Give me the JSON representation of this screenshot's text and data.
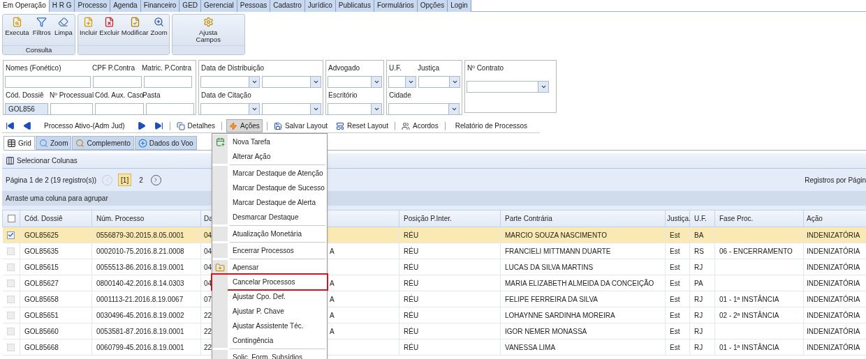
{
  "main_tabs": [
    {
      "label": "Em Operação",
      "selected": true
    },
    {
      "label": "H R G",
      "selected": false
    },
    {
      "label": "Processo",
      "selected": false
    },
    {
      "label": "Agenda",
      "selected": false
    },
    {
      "label": "Financeiro",
      "selected": false
    },
    {
      "label": "GED",
      "selected": false
    },
    {
      "label": "Gerencial",
      "selected": false
    },
    {
      "label": "Pessoas",
      "selected": false
    },
    {
      "label": "Cadastro",
      "selected": false
    },
    {
      "label": "Jurídico",
      "selected": false
    },
    {
      "label": "Publicatus",
      "selected": false
    },
    {
      "label": "Formulários",
      "selected": false
    },
    {
      "label": "Opções",
      "selected": false
    },
    {
      "label": "Login",
      "selected": false
    }
  ],
  "ribbon_groups": [
    {
      "label": "Consulta",
      "buttons": [
        "Executa",
        "Filtros",
        "Limpa"
      ]
    },
    {
      "buttons": [
        "Incluir",
        "Excluir",
        "Modificar",
        "Zoom"
      ]
    },
    {
      "buttons": [
        "Ajusta Campos"
      ]
    }
  ],
  "filter_boxes": [
    {
      "rows": [
        {
          "labels": [
            "Nomes (Fonético)",
            "CPF P.Contra",
            "Matric. P.Contra"
          ],
          "fields": [
            {
              "kind": "text"
            },
            {
              "kind": "text"
            },
            {
              "kind": "text"
            }
          ]
        },
        {
          "labels": [
            "Cód. Dossiê",
            "Nº Processual",
            "Cód. Aux. Caso",
            "Pasta"
          ],
          "fields": [
            {
              "kind": "text",
              "value": "GOL856",
              "focused": true
            },
            {
              "kind": "text"
            },
            {
              "kind": "text"
            },
            {
              "kind": "text"
            }
          ]
        }
      ]
    },
    {
      "rows": [
        {
          "labels": [
            "Data de Distribuição"
          ],
          "fields": [
            {
              "kind": "select"
            },
            {
              "kind": "select"
            }
          ]
        },
        {
          "labels": [
            "Data de Citação"
          ],
          "fields": [
            {
              "kind": "select"
            },
            {
              "kind": "select"
            }
          ]
        }
      ]
    },
    {
      "rows": [
        {
          "labels": [
            "Advogado"
          ],
          "fields": [
            {
              "kind": "select"
            }
          ]
        },
        {
          "labels": [
            "Escritório"
          ],
          "fields": [
            {
              "kind": "select"
            }
          ]
        }
      ]
    },
    {
      "rows": [
        {
          "labels": [
            "U.F.",
            "Justiça"
          ],
          "fields": [
            {
              "kind": "select"
            },
            {
              "kind": "select"
            }
          ]
        },
        {
          "labels": [
            "Cidade"
          ],
          "fields": [
            {
              "kind": "select"
            }
          ]
        }
      ]
    },
    {
      "rows": [
        {
          "labels": [
            "Nº Contrato"
          ],
          "fields": [
            {
              "kind": "select"
            }
          ]
        }
      ]
    }
  ],
  "toolbar": [
    {
      "kind": "first"
    },
    {
      "kind": "prev"
    },
    {
      "kind": "text",
      "label": "Processo Ativo-(Adm Jud)"
    },
    {
      "kind": "next"
    },
    {
      "kind": "last"
    },
    {
      "kind": "separator"
    },
    {
      "kind": "details",
      "label": "Detalhes"
    },
    {
      "kind": "separator"
    },
    {
      "kind": "actions",
      "label": "Ações",
      "pressed": true
    },
    {
      "kind": "separator"
    },
    {
      "kind": "save",
      "label": "Salvar Layout"
    },
    {
      "kind": "reset",
      "label": "Reset Layout"
    },
    {
      "kind": "separator"
    },
    {
      "kind": "deals",
      "label": "Acordos"
    },
    {
      "kind": "separator"
    },
    {
      "kind": "text",
      "label": "Relatório de Processos"
    }
  ],
  "view_tabs": [
    {
      "label": "Grid",
      "selected": true
    },
    {
      "label": "Zoom",
      "selected": false
    },
    {
      "label": "Complemento",
      "selected": false
    },
    {
      "label": "Dados do Voo",
      "selected": false
    }
  ],
  "select_columns_button": "Selecionar Colunas",
  "pagination": {
    "summary": "Página 1 de 2 (19 registro(s))",
    "pages": [
      {
        "label": "[1]",
        "selected": true
      },
      {
        "label": "2",
        "selected": false
      }
    ],
    "prev_disabled": true,
    "per_page_label": "Registros por Págin"
  },
  "group_hint": "Arraste uma coluna para agrupar",
  "table": {
    "select_all_checked": false,
    "columns": [
      "Cód. Dossiê",
      "Núm. Processo",
      "Da",
      "",
      "Posição P.Inter.",
      "Parte Contrária",
      "Justiça.",
      "U.F.",
      "Fase Proc.",
      "Ação"
    ],
    "rows": [
      {
        "checked": true,
        "selected": true,
        "cells": [
          "GOL85625",
          "0556879-30.2015.8.05.0001",
          "04",
          "",
          "RÉU",
          "MARCIO SOUZA NASCIMENTO",
          "Est",
          "BA",
          "",
          "INDENIZATÓRIA"
        ]
      },
      {
        "checked": false,
        "selected": false,
        "cells": [
          "GOL85635",
          "0002010-75.2016.8.21.0008",
          "04",
          "A",
          "RÉU",
          "FRANCIELI MITTMANN DUARTE",
          "Est",
          "RS",
          "06 - ENCERRAMENTO",
          "INDENIZATÓRIA"
        ]
      },
      {
        "checked": false,
        "selected": false,
        "cells": [
          "GOL85615",
          "0055513-86.2016.8.19.0001",
          "04",
          "",
          "RÉU",
          "LUCAS DA SILVA MARTINS",
          "Est",
          "RJ",
          "",
          "INDENIZATÓRIA"
        ]
      },
      {
        "checked": false,
        "selected": false,
        "cells": [
          "GOL85627",
          "0800140-42.2016.8.14.0303",
          "04",
          "A",
          "RÉU",
          "MARIA ELIZABETH ALMEIDA DA CONCEIÇÃO",
          "Est",
          "PA",
          "",
          "INDENIZATÓRIA"
        ]
      },
      {
        "checked": false,
        "selected": false,
        "cells": [
          "GOL85658",
          "0001113-21.2016.8.19.0067",
          "07",
          "A",
          "RÉU",
          "FELIPE FERREIRA DA SILVA",
          "Est",
          "RJ",
          "01 - 1ª INSTÂNCIA",
          "INDENIZATÓRIA"
        ]
      },
      {
        "checked": false,
        "selected": false,
        "cells": [
          "GOL85651",
          "0030496-45.2016.8.19.0002",
          "22",
          "A",
          "RÉU",
          "LOHAYNNE SARDINHA MOREIRA",
          "Est",
          "RJ",
          "02 - 2ª INSTÂNCIA",
          "INDENIZATÓRIA"
        ]
      },
      {
        "checked": false,
        "selected": false,
        "cells": [
          "GOL85660",
          "0053581-87.2016.8.19.0001",
          "22",
          "A",
          "RÉU",
          "IGOR NEMER MONASSA",
          "Est",
          "RJ",
          "",
          "INDENIZATÓRIA"
        ]
      },
      {
        "checked": false,
        "selected": false,
        "cells": [
          "GOL85668",
          "0060799-45.2016.8.19.0001",
          "22",
          "",
          "RÉU",
          "VANESSA LIMA",
          "Est",
          "RJ",
          "01 - 1ª INSTÂNCIA",
          "INDENIZATÓRIA"
        ]
      }
    ]
  },
  "actions_menu": [
    {
      "kind": "new-task",
      "label": "Nova Tarefa"
    },
    {
      "kind": "item",
      "label": "Alterar Ação"
    },
    {
      "kind": "separator"
    },
    {
      "kind": "item",
      "label": "Marcar Destaque de Atenção"
    },
    {
      "kind": "item",
      "label": "Marcar Destaque de Sucesso"
    },
    {
      "kind": "item",
      "label": "Marcar Destaque de Alerta"
    },
    {
      "kind": "item",
      "label": "Desmarcar Destaque"
    },
    {
      "kind": "separator"
    },
    {
      "kind": "item",
      "label": "Atualização Monetária"
    },
    {
      "kind": "separator"
    },
    {
      "kind": "item",
      "label": "Encerrar Processos"
    },
    {
      "kind": "separator"
    },
    {
      "kind": "attach",
      "label": "Apensar"
    },
    {
      "kind": "item",
      "label": "Cancelar Processos",
      "highlighted": true
    },
    {
      "kind": "item",
      "label": "Ajustar Cpo. Def."
    },
    {
      "kind": "item",
      "label": "Ajustar P. Chave"
    },
    {
      "kind": "item",
      "label": "Ajustar Assistente Téc."
    },
    {
      "kind": "item",
      "label": "Contingência"
    },
    {
      "kind": "separator"
    },
    {
      "kind": "item",
      "label": "Solic. Form. Subsídios"
    }
  ]
}
